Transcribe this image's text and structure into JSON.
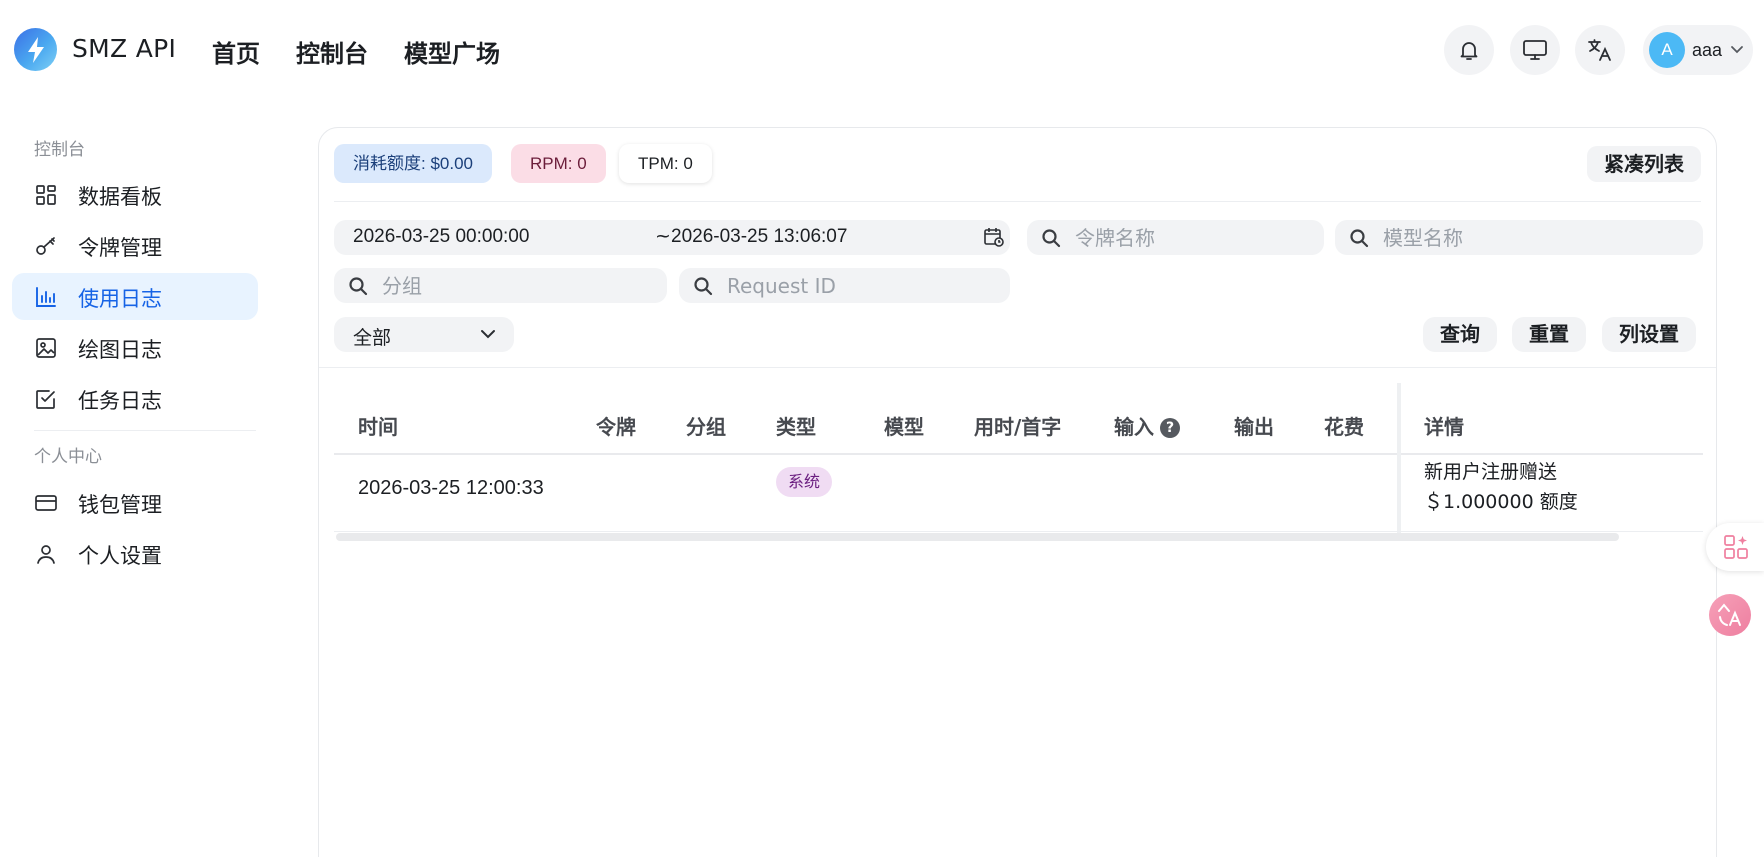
{
  "header": {
    "brand": "SMZ API",
    "nav": [
      "首页",
      "控制台",
      "模型广场"
    ],
    "icons": [
      "bell-icon",
      "monitor-icon",
      "translate-icon"
    ],
    "user": {
      "initial": "A",
      "name": "aaa"
    }
  },
  "sidebar": {
    "section1": "控制台",
    "items1": [
      {
        "label": "数据看板",
        "icon": "dashboard-icon"
      },
      {
        "label": "令牌管理",
        "icon": "key-icon"
      },
      {
        "label": "使用日志",
        "icon": "bar-chart-icon",
        "active": true
      },
      {
        "label": "绘图日志",
        "icon": "image-icon"
      },
      {
        "label": "任务日志",
        "icon": "checkbox-icon"
      }
    ],
    "section2": "个人中心",
    "items2": [
      {
        "label": "钱包管理",
        "icon": "wallet-icon"
      },
      {
        "label": "个人设置",
        "icon": "user-icon"
      }
    ]
  },
  "stats": {
    "consumed": "消耗额度: $0.00",
    "rpm": "RPM: 0",
    "tpm": "TPM: 0"
  },
  "compact_button": "紧凑列表",
  "filters": {
    "date_start": "2026-03-25 00:00:00",
    "date_sep": "~",
    "date_end": "2026-03-25 13:06:07",
    "token_placeholder": "令牌名称",
    "model_placeholder": "模型名称",
    "group_placeholder": "分组",
    "request_placeholder": "Request ID",
    "type_select": "全部"
  },
  "actions": {
    "query": "查询",
    "reset": "重置",
    "columns": "列设置"
  },
  "table": {
    "headers": [
      "时间",
      "令牌",
      "分组",
      "类型",
      "模型",
      "用时/首字",
      "输入",
      "输出",
      "花费",
      "详情"
    ],
    "rows": [
      {
        "time": "2026-03-25 12:00:33",
        "token": "",
        "group": "",
        "type": "系统",
        "model": "",
        "duration": "",
        "input": "",
        "output": "",
        "cost": "",
        "detail_line1": "新用户注册赠送",
        "detail_line2": "＄1.000000 额度"
      }
    ]
  },
  "colors": {
    "accent": "#1663e6",
    "active_bg": "#e8f3ff",
    "tag_bg": "#f0dcf3"
  }
}
